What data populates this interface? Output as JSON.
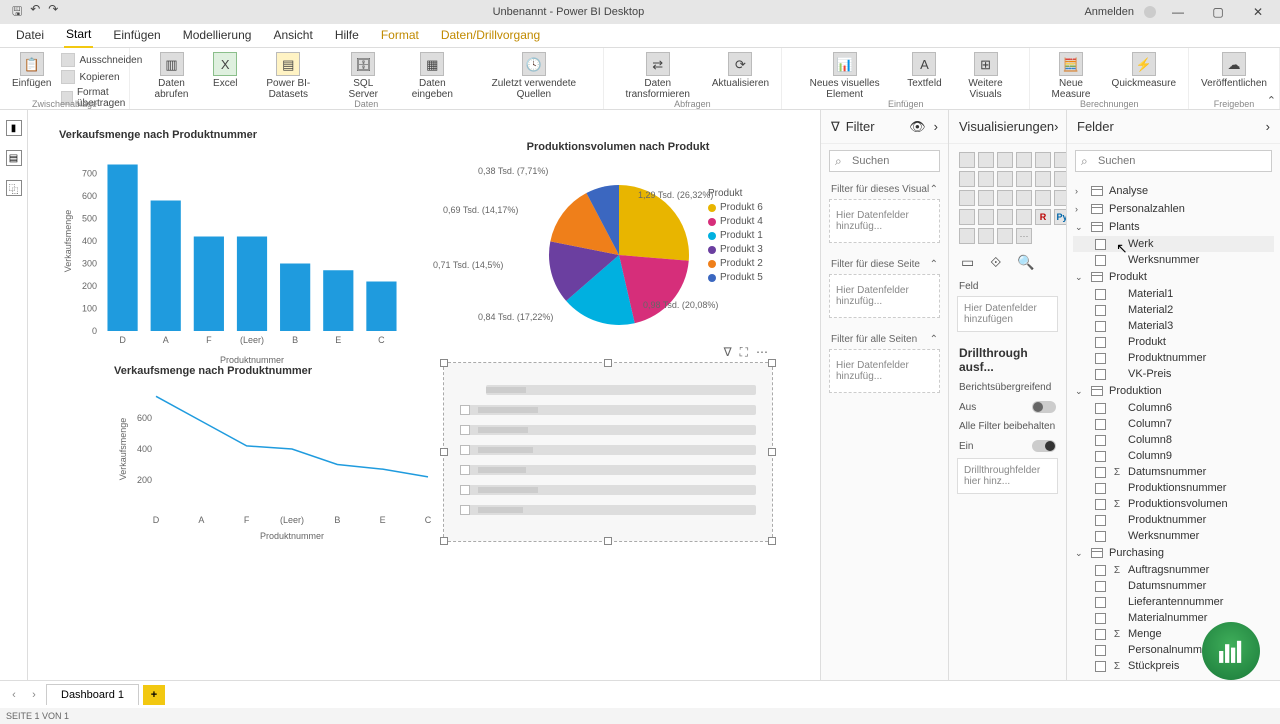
{
  "titlebar": {
    "title": "Unbenannt - Power BI Desktop",
    "signin": "Anmelden"
  },
  "menu": {
    "file": "Datei",
    "home": "Start",
    "insert": "Einfügen",
    "modeling": "Modellierung",
    "view": "Ansicht",
    "help": "Hilfe",
    "format": "Format",
    "datadrill": "Daten/Drillvorgang"
  },
  "ribbon": {
    "clipboard": {
      "paste": "Einfügen",
      "cut": "Ausschneiden",
      "copy": "Kopieren",
      "formatpainter": "Format übertragen",
      "group": "Zwischenablage"
    },
    "data": {
      "getdata": "Daten\nabrufen",
      "excel": "Excel",
      "pbidatasets": "Power\nBI-Datasets",
      "sql": "SQL\nServer",
      "enter": "Daten\neingeben",
      "recent": "Zuletzt verwendete\nQuellen",
      "group": "Daten"
    },
    "queries": {
      "transform": "Daten\ntransformieren",
      "refresh": "Aktualisieren",
      "group": "Abfragen"
    },
    "insert": {
      "newvisual": "Neues visuelles\nElement",
      "textbox": "Textfeld",
      "morevisuals": "Weitere\nVisuals",
      "group": "Einfügen"
    },
    "calc": {
      "newmeasure": "Neue\nMeasure",
      "quickmeasure": "Quickmeasure",
      "group": "Berechnungen"
    },
    "share": {
      "publish": "Veröffentlichen",
      "group": "Freigeben"
    }
  },
  "chart_data": [
    {
      "type": "bar",
      "title": "Verkaufsmenge nach Produktnummer",
      "categories": [
        "D",
        "A",
        "F",
        "(Leer)",
        "B",
        "E",
        "C"
      ],
      "values": [
        740,
        580,
        420,
        420,
        300,
        270,
        220
      ],
      "xlabel": "Produktnummer",
      "ylabel": "Verkaufsmenge",
      "ylim": [
        0,
        800
      ],
      "yticks": [
        0,
        100,
        200,
        300,
        400,
        500,
        600,
        700
      ]
    },
    {
      "type": "pie",
      "title": "Produktionsvolumen nach Produkt",
      "series_name": "Produkt",
      "slices": [
        {
          "label": "Produkt 6",
          "value": 1290,
          "pct": 26.32,
          "text": "1,29 Tsd. (26,32%)",
          "color": "#e8b500"
        },
        {
          "label": "Produkt 4",
          "value": 980,
          "pct": 20.08,
          "text": "0,98 Tsd. (20,08%)",
          "color": "#d62e7a"
        },
        {
          "label": "Produkt 1",
          "value": 840,
          "pct": 17.22,
          "text": "0,84 Tsd. (17,22%)",
          "color": "#00b0e0"
        },
        {
          "label": "Produkt 3",
          "value": 710,
          "pct": 14.5,
          "text": "0,71 Tsd. (14,5%)",
          "color": "#6b3fa0"
        },
        {
          "label": "Produkt 2",
          "value": 690,
          "pct": 14.17,
          "text": "0,69 Tsd. (14,17%)",
          "color": "#ef7f1a"
        },
        {
          "label": "Produkt 5",
          "value": 380,
          "pct": 7.71,
          "text": "0,38 Tsd. (7,71%)",
          "color": "#3b67c0"
        }
      ]
    },
    {
      "type": "line",
      "title": "Verkaufsmenge nach Produktnummer",
      "categories": [
        "D",
        "A",
        "F",
        "(Leer)",
        "B",
        "E",
        "C"
      ],
      "values": [
        740,
        580,
        420,
        400,
        300,
        270,
        220
      ],
      "xlabel": "Produktnummer",
      "ylabel": "Verkaufsmenge",
      "yticks": [
        200,
        400,
        600
      ]
    }
  ],
  "filter": {
    "header": "Filter",
    "search_ph": "Suchen",
    "sec_visual": "Filter für dieses Visual",
    "sec_page": "Filter für diese Seite",
    "sec_all": "Filter für alle Seiten",
    "drop": "Hier Datenfelder hinzufüg..."
  },
  "viz": {
    "header": "Visualisierungen",
    "field_label": "Feld",
    "field_drop": "Hier Datenfelder hinzufügen",
    "drill_header": "Drillthrough ausf...",
    "cross": "Berichtsübergreifend",
    "off": "Aus",
    "keepfilters": "Alle Filter beibehalten",
    "on": "Ein",
    "drill_drop": "Drillthroughfelder hier hinz..."
  },
  "fields": {
    "header": "Felder",
    "search_ph": "Suchen",
    "tables": [
      {
        "name": "Analyse",
        "expanded": false,
        "fields": []
      },
      {
        "name": "Personalzahlen",
        "expanded": false,
        "fields": []
      },
      {
        "name": "Plants",
        "expanded": true,
        "fields": [
          {
            "name": "Werk",
            "hover": true
          },
          {
            "name": "Werksnummer"
          }
        ]
      },
      {
        "name": "Produkt",
        "expanded": true,
        "fields": [
          {
            "name": "Material1"
          },
          {
            "name": "Material2"
          },
          {
            "name": "Material3"
          },
          {
            "name": "Produkt"
          },
          {
            "name": "Produktnummer"
          },
          {
            "name": "VK-Preis"
          }
        ]
      },
      {
        "name": "Produktion",
        "expanded": true,
        "fields": [
          {
            "name": "Column6"
          },
          {
            "name": "Column7"
          },
          {
            "name": "Column8"
          },
          {
            "name": "Column9"
          },
          {
            "name": "Datumsnummer",
            "sigma": true
          },
          {
            "name": "Produktionsnummer"
          },
          {
            "name": "Produktionsvolumen",
            "sigma": true
          },
          {
            "name": "Produktnummer"
          },
          {
            "name": "Werksnummer"
          }
        ]
      },
      {
        "name": "Purchasing",
        "expanded": true,
        "fields": [
          {
            "name": "Auftragsnummer",
            "sigma": true
          },
          {
            "name": "Datumsnummer"
          },
          {
            "name": "Lieferantennummer"
          },
          {
            "name": "Materialnummer"
          },
          {
            "name": "Menge",
            "sigma": true
          },
          {
            "name": "Personalnummer"
          },
          {
            "name": "Stückpreis",
            "sigma": true
          }
        ]
      }
    ]
  },
  "bottom": {
    "tab": "Dashboard 1"
  },
  "status": "SEITE 1 VON 1"
}
